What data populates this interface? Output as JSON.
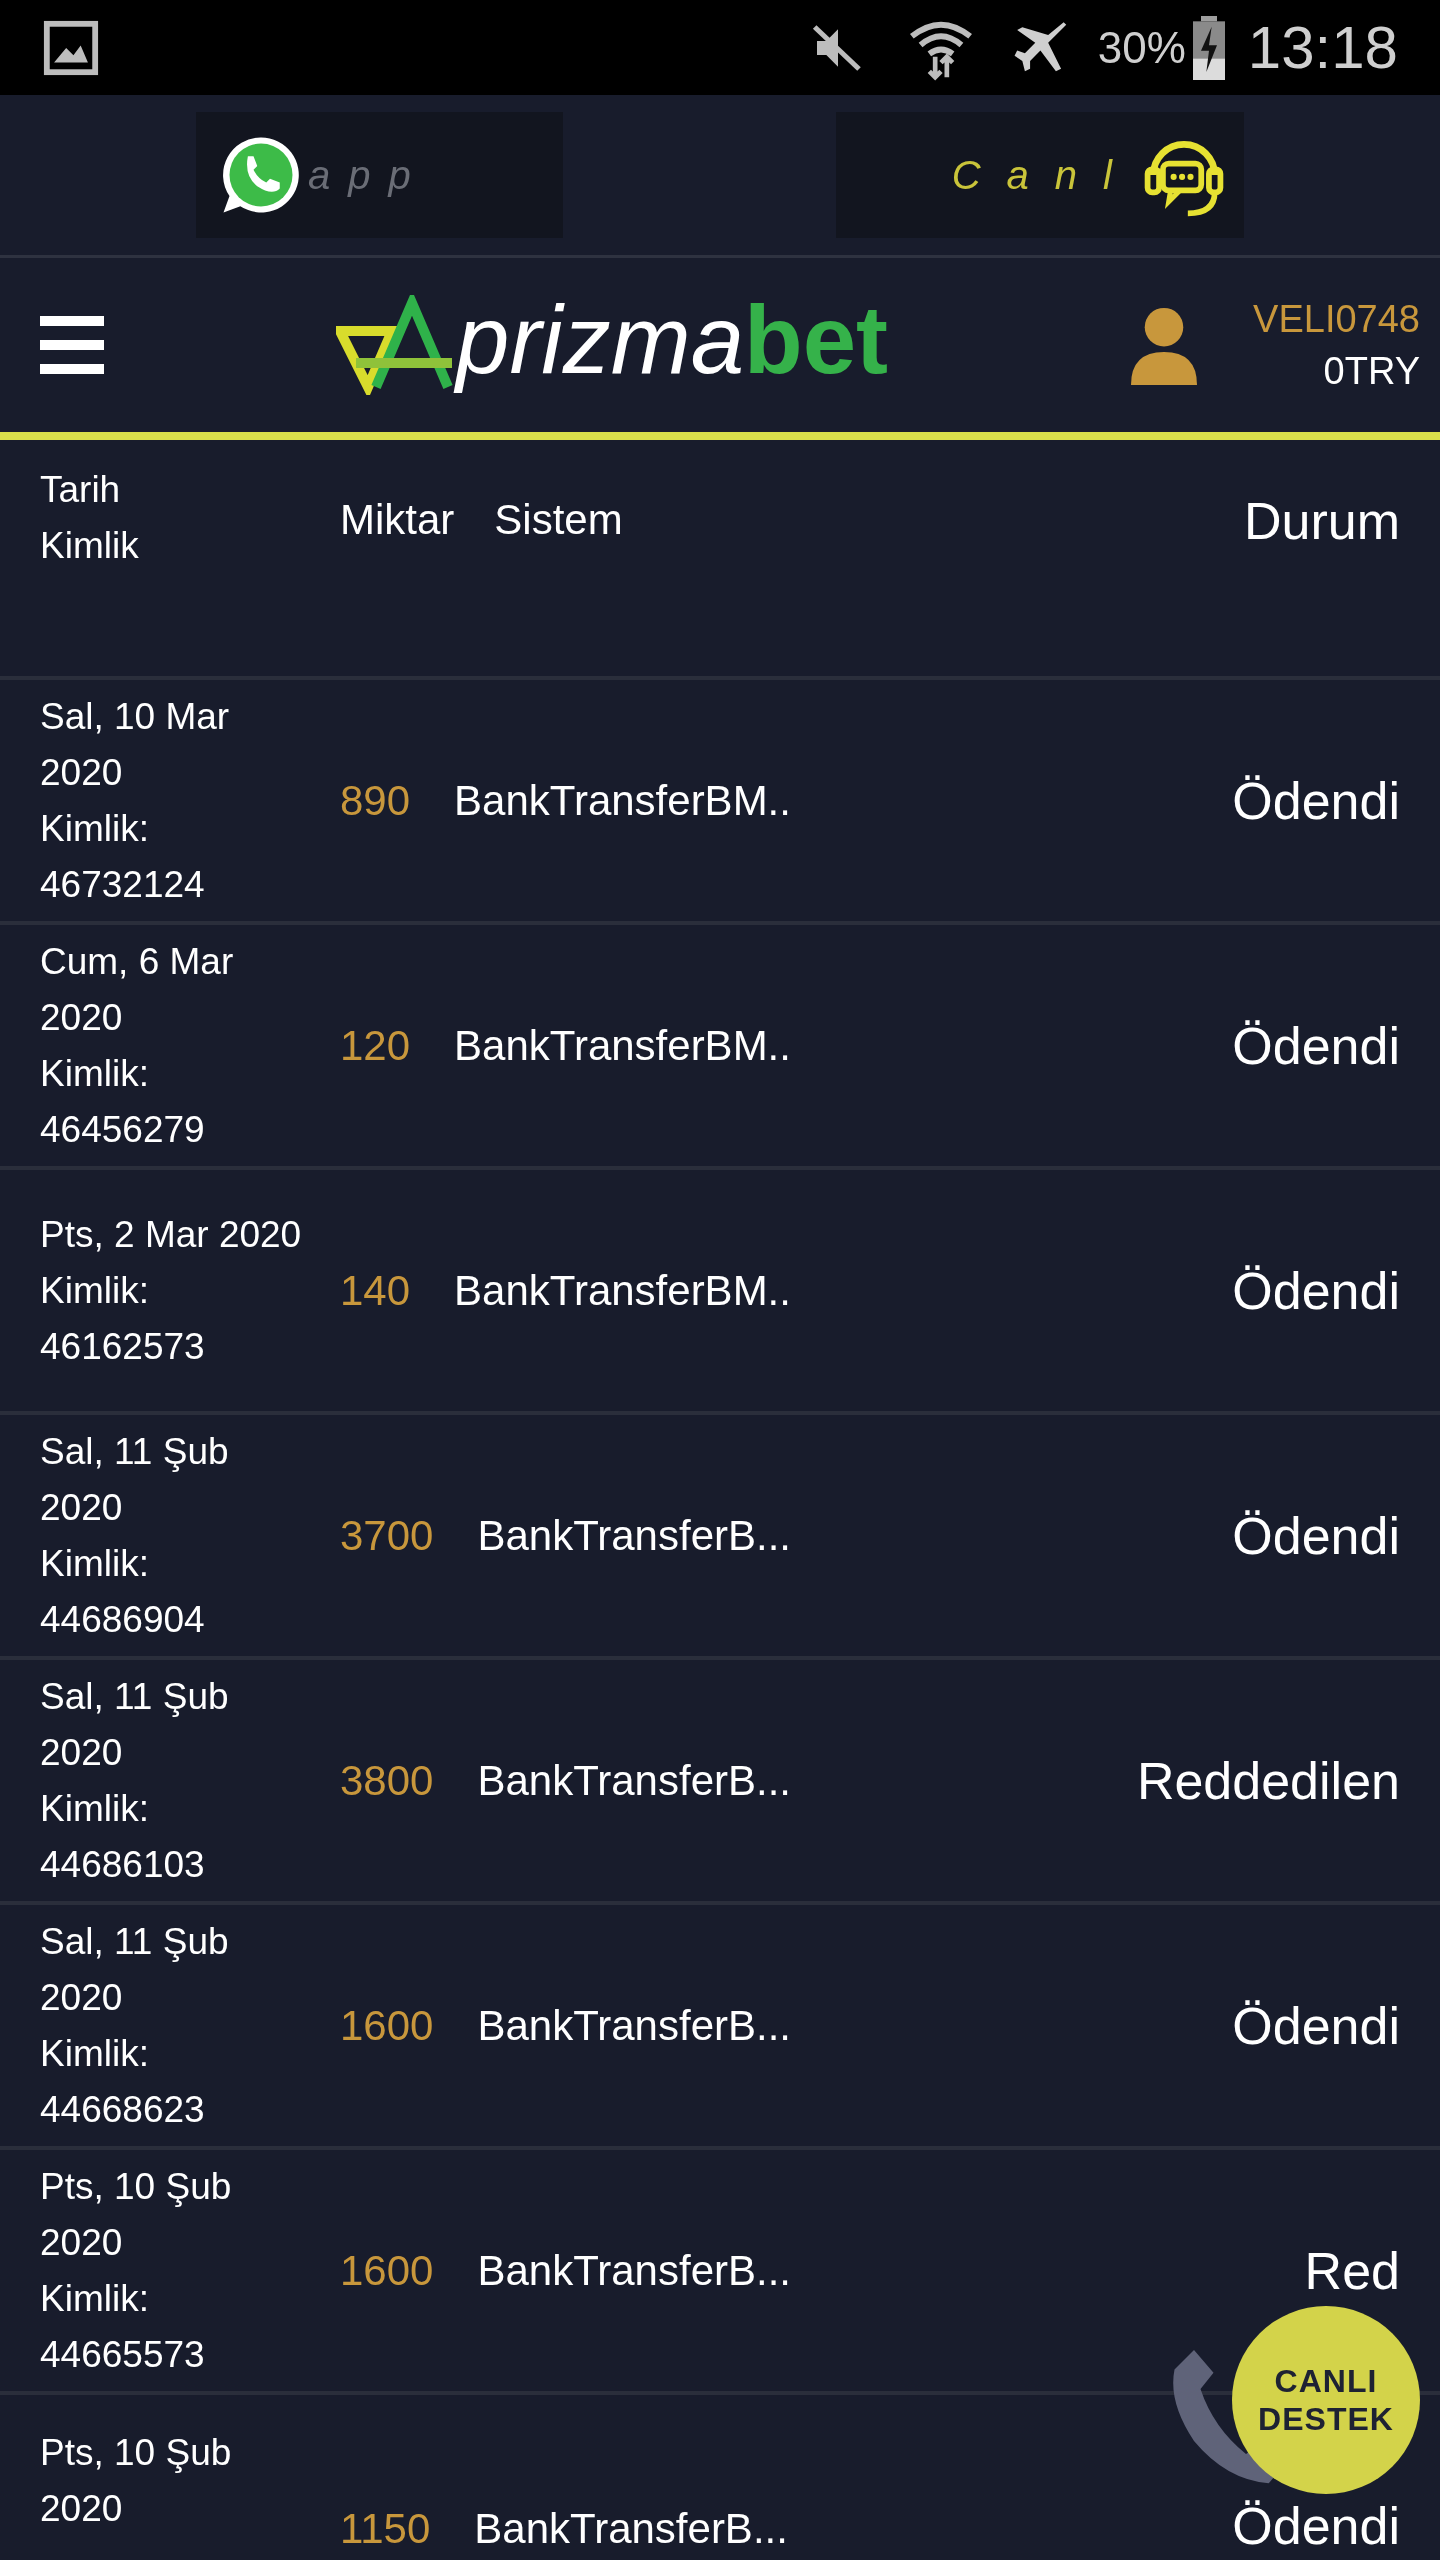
{
  "status_bar": {
    "battery": "30%",
    "time": "13:18"
  },
  "banner": {
    "whatsapp_text": "app",
    "live_text": "Canl"
  },
  "header": {
    "logo": {
      "part_1": "prizma",
      "part_2": "bet"
    },
    "username": "VELI0748",
    "balance": "0TRY"
  },
  "table": {
    "columns": {
      "date": [
        "Tarih",
        "Kimlik"
      ],
      "amount": "Miktar",
      "system": "Sistem",
      "status": "Durum"
    },
    "rows": [
      {
        "date_lines": [
          "Sal, 10 Mar",
          "2020"
        ],
        "id_label": "Kimlik:",
        "id": "46732124",
        "amount": "890",
        "system": "BankTransferBM..",
        "status": "Ödendi"
      },
      {
        "date_lines": [
          "Cum, 6 Mar",
          "2020"
        ],
        "id_label": "Kimlik:",
        "id": "46456279",
        "amount": "120",
        "system": "BankTransferBM..",
        "status": "Ödendi"
      },
      {
        "date_lines": [
          "Pts, 2 Mar 2020"
        ],
        "id_label": "Kimlik:",
        "id": "46162573",
        "amount": "140",
        "system": "BankTransferBM..",
        "status": "Ödendi"
      },
      {
        "date_lines": [
          "Sal, 11 Şub",
          "2020"
        ],
        "id_label": "Kimlik:",
        "id": "44686904",
        "amount": "3700",
        "system": "BankTransferB...",
        "status": "Ödendi"
      },
      {
        "date_lines": [
          "Sal, 11 Şub",
          "2020"
        ],
        "id_label": "Kimlik:",
        "id": "44686103",
        "amount": "3800",
        "system": "BankTransferB...",
        "status": "Reddedilen"
      },
      {
        "date_lines": [
          "Sal, 11 Şub",
          "2020"
        ],
        "id_label": "Kimlik:",
        "id": "44668623",
        "amount": "1600",
        "system": "BankTransferB...",
        "status": "Ödendi"
      },
      {
        "date_lines": [
          "Pts, 10 Şub",
          "2020"
        ],
        "id_label": "Kimlik:",
        "id": "44665573",
        "amount": "1600",
        "system": "BankTransferB...",
        "status": "Red"
      },
      {
        "date_lines": [
          "Pts, 10 Şub",
          "2020"
        ],
        "amount": "1150",
        "system": "BankTransferB...",
        "status": "Ödendi"
      }
    ]
  },
  "support_badge": {
    "line_1": "CANLI",
    "line_2": "DESTEK"
  }
}
